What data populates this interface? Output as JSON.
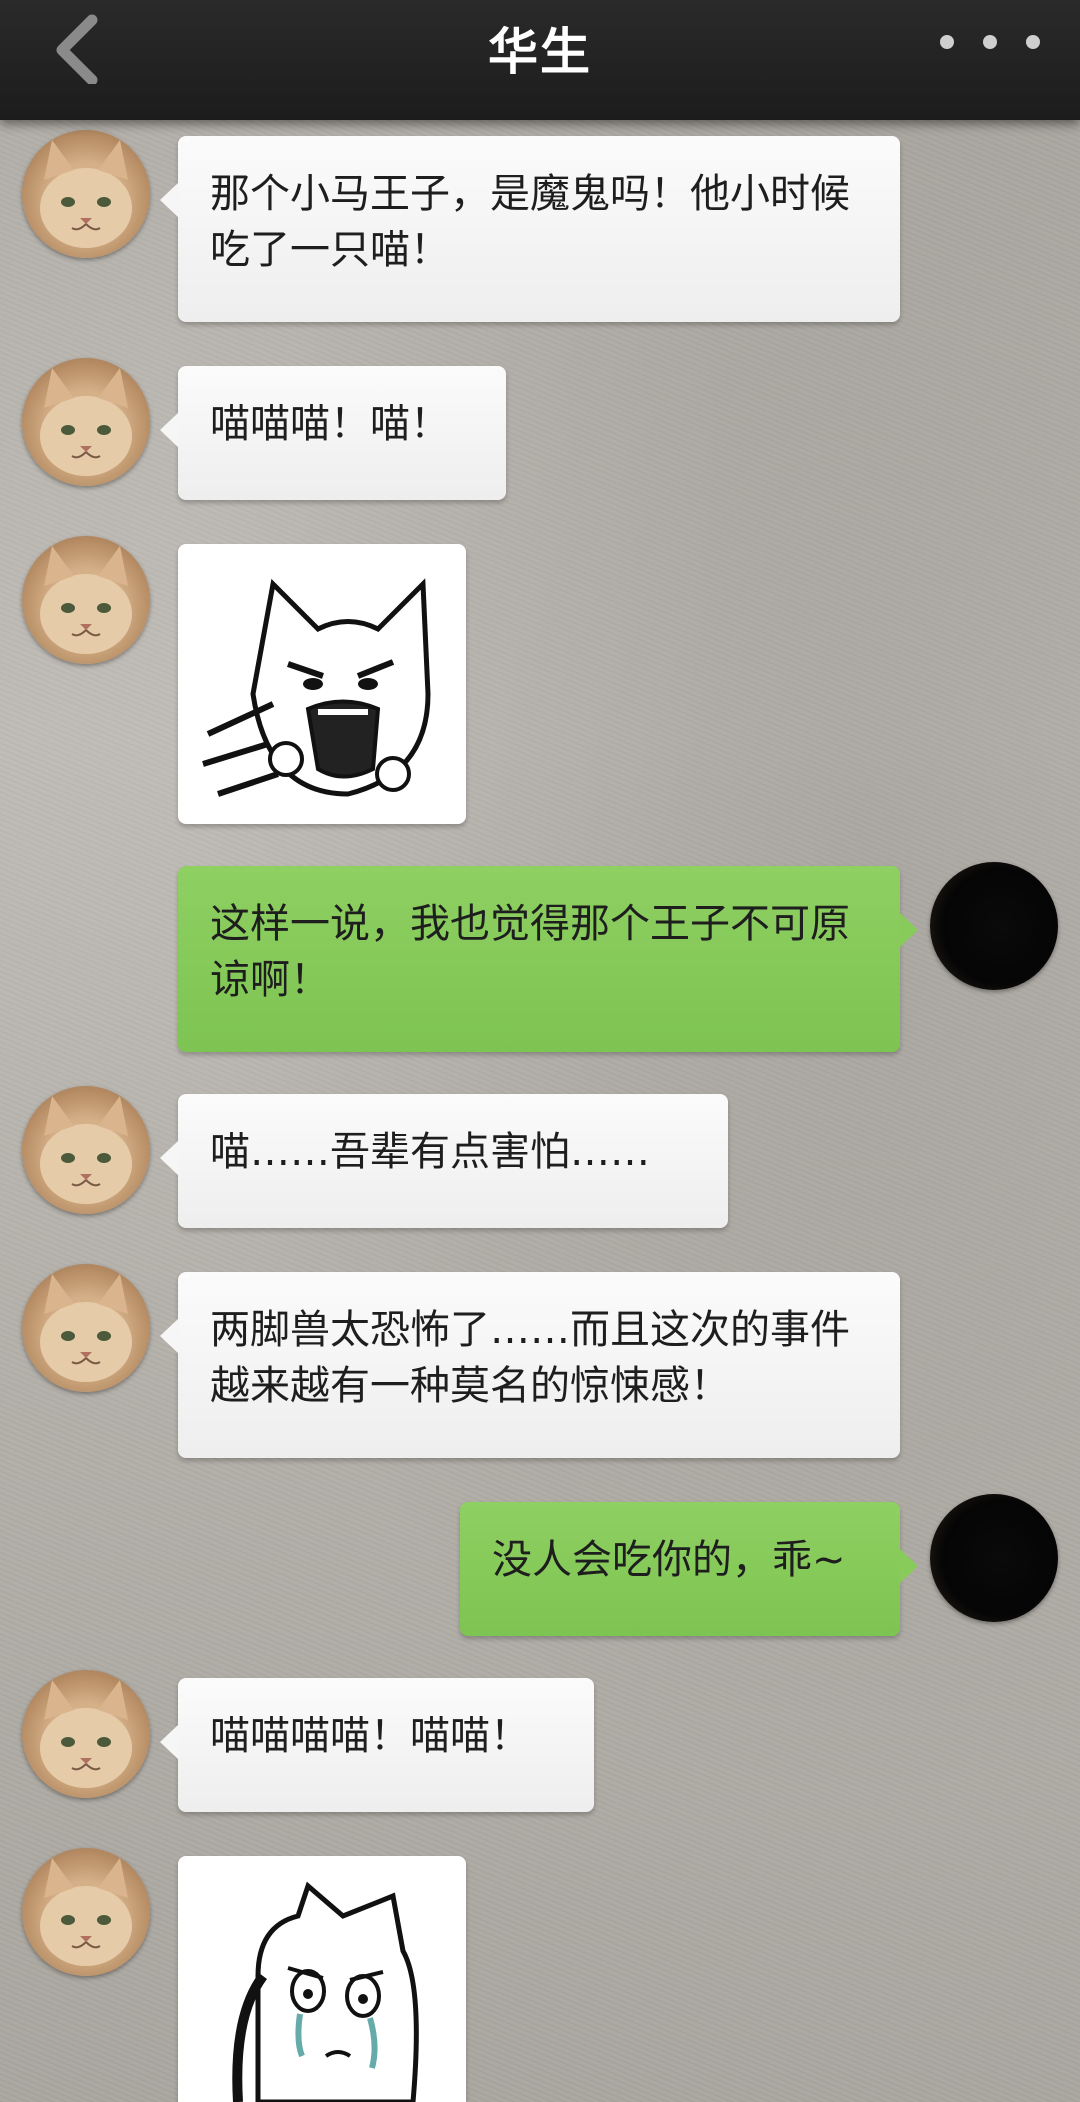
{
  "header": {
    "title": "华生",
    "back_icon": "chevron-left-icon",
    "more_icon": "more-dots-icon"
  },
  "messages": [
    {
      "from": "contact",
      "type": "text",
      "text": "那个小马王子，是魔鬼吗！他小时候吃了一只喵！"
    },
    {
      "from": "contact",
      "type": "text",
      "text": "喵喵喵！喵！"
    },
    {
      "from": "contact",
      "type": "sticker",
      "sticker": "screaming-cat-sticker"
    },
    {
      "from": "me",
      "type": "text",
      "text": "这样一说，我也觉得那个王子不可原谅啊！"
    },
    {
      "from": "contact",
      "type": "text",
      "text": "喵……吾辈有点害怕……"
    },
    {
      "from": "contact",
      "type": "text",
      "text": "两脚兽太恐怖了……而且这次的事件越来越有一种莫名的惊悚感！"
    },
    {
      "from": "me",
      "type": "text",
      "text": "没人会吃你的，乖~"
    },
    {
      "from": "contact",
      "type": "text",
      "text": "喵喵喵喵！喵喵！"
    },
    {
      "from": "contact",
      "type": "sticker",
      "sticker": "crying-cat-sticker"
    }
  ],
  "colors": {
    "header_bg": "#1f1f1f",
    "incoming_bubble": "#f4f4f4",
    "outgoing_bubble": "#86ca58"
  }
}
